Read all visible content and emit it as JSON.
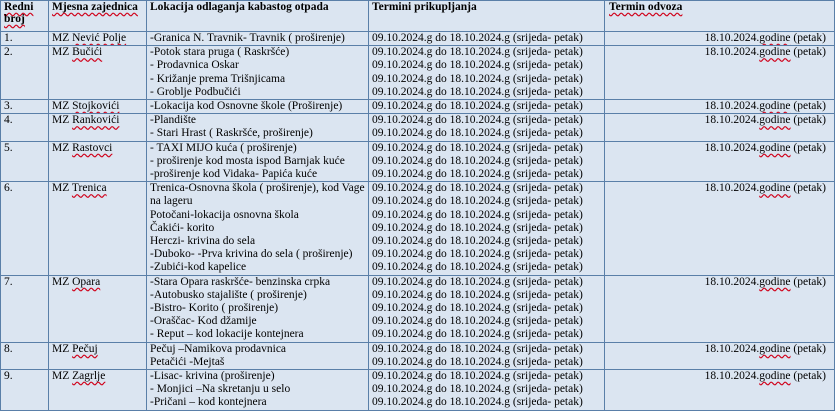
{
  "headers": [
    "Redni broj",
    "Mjesna zajednica",
    "Lokacija odlaganja kabastog otpada",
    "Termini prikupljanja",
    "Termin odvoza"
  ],
  "rows": [
    {
      "num": "1.",
      "mz": "MZ Nević Polje",
      "locations": [
        "-Granica N. Travnik- Travnik   ( proširenje)"
      ],
      "pickups": [
        "09.10.2024.g do 18.10.2024.g (srijeda- petak)"
      ],
      "removal": "18.10.2024.godine (petak)"
    },
    {
      "num": "2.",
      "mz": "MZ Bučići",
      "locations": [
        "-Potok stara pruga ( Raskršće)",
        "- Prodavnica Oskar",
        "- Križanje prema Trišnjicama",
        "- Groblje Podbučići"
      ],
      "pickups": [
        "09.10.2024.g do 18.10.2024.g (srijeda- petak)",
        "09.10.2024.g do 18.10.2024.g (srijeda- petak)",
        "09.10.2024.g do 18.10.2024.g (srijeda- petak)",
        "09.10.2024.g do 18.10.2024.g (srijeda- petak)"
      ],
      "removal": "18.10.2024.godine (petak)"
    },
    {
      "num": "3.",
      "mz": "MZ Stojkovići",
      "locations": [
        "-Lokacija kod Osnovne škole (Proširenje)"
      ],
      "pickups": [
        "09.10.2024.g do 18.10.2024.g (srijeda- petak)"
      ],
      "removal": "18.10.2024.godine (petak)"
    },
    {
      "num": "4.",
      "mz": "MZ Rankovići",
      "locations": [
        "-Plandište",
        "- Stari Hrast ( Raskršće, proširenje)"
      ],
      "pickups": [
        "09.10.2024.g do 18.10.2024.g (srijeda- petak)",
        "09.10.2024.g do 18.10.2024.g (srijeda- petak)"
      ],
      "removal": "18.10.2024.godine (petak)"
    },
    {
      "num": "5.",
      "mz": "MZ Rastovci",
      "locations": [
        "- TAXI MIJO kuća ( proširenje)",
        "- proširenje kod mosta ispod Barnjak kuće",
        "-proširenje kod Vidaka- Papića kuće"
      ],
      "pickups": [
        "09.10.2024.g do 18.10.2024.g (srijeda- petak)",
        "09.10.2024.g do 18.10.2024.g (srijeda- petak)",
        "09.10.2024.g do 18.10.2024.g (srijeda- petak)"
      ],
      "removal": "18.10.2024.godine (petak)"
    },
    {
      "num": "6.",
      "mz": "MZ Trenica",
      "locations": [
        "Trenica-Osnovna škola ( proširenje), kod Vage",
        "na lageru",
        "Potočani-lokacija   osnovna škola",
        "Čakići- korito",
        "Herczi- krivina do sela",
        "-Duboko- -Prva krivina do sela ( proširenje)",
        "-Zubići-kod kapelice"
      ],
      "pickups": [
        "09.10.2024.g do 18.10.2024.g (srijeda- petak)",
        "09.10.2024.g do 18.10.2024.g (srijeda- petak)",
        "09.10.2024.g do 18.10.2024.g (srijeda- petak)",
        "09.10.2024.g do 18.10.2024.g (srijeda- petak)",
        "09.10.2024.g do 18.10.2024.g (srijeda- petak)",
        "09.10.2024.g do 18.10.2024.g (srijeda- petak)",
        "09.10.2024.g do 18.10.2024.g (srijeda- petak)"
      ],
      "removal": "18.10.2024.godine (petak)"
    },
    {
      "num": "7.",
      "mz": "MZ Opara",
      "locations": [
        "-Stara Opara raskršće-  benzinska crpka",
        "-Autobusko stajalište ( proširenje)",
        "-Bistro- Korito ( proširenje)",
        "-Oraščac- Kod džamije",
        "- Reput – kod lokacije kontejnera"
      ],
      "pickups": [
        "09.10.2024.g do 18.10.2024.g (srijeda- petak)",
        "09.10.2024.g do 18.10.2024.g (srijeda- petak)",
        "09.10.2024.g do 18.10.2024.g (srijeda- petak)",
        "09.10.2024.g do 18.10.2024.g (srijeda- petak)",
        "09.10.2024.g do 18.10.2024.g (srijeda- petak)"
      ],
      "removal": "18.10.2024.godine (petak)"
    },
    {
      "num": "8.",
      "mz": "MZ Pečuj",
      "locations": [
        "Pečuj –Namikova prodavnica",
        "Petačići -Mejtaš"
      ],
      "pickups": [
        "09.10.2024.g do 18.10.2024.g (srijeda- petak)",
        "09.10.2024.g do 18.10.2024.g (srijeda- petak)"
      ],
      "removal": "18.10.2024.godine (petak)"
    },
    {
      "num": "9.",
      "mz": "MZ Zagrlje",
      "locations": [
        "-Lisac- krivina (proširenje)",
        "- Monjici –Na skretanju u selo",
        "-Pričani – kod kontejnera"
      ],
      "pickups": [
        "09.10.2024.g do 18.10.2024.g (srijeda- petak)",
        "09.10.2024.g do 18.10.2024.g (srijeda- petak)",
        "09.10.2024.g do 18.10.2024.g (srijeda- petak)"
      ],
      "removal": "18.10.2024.godine (petak)"
    }
  ]
}
